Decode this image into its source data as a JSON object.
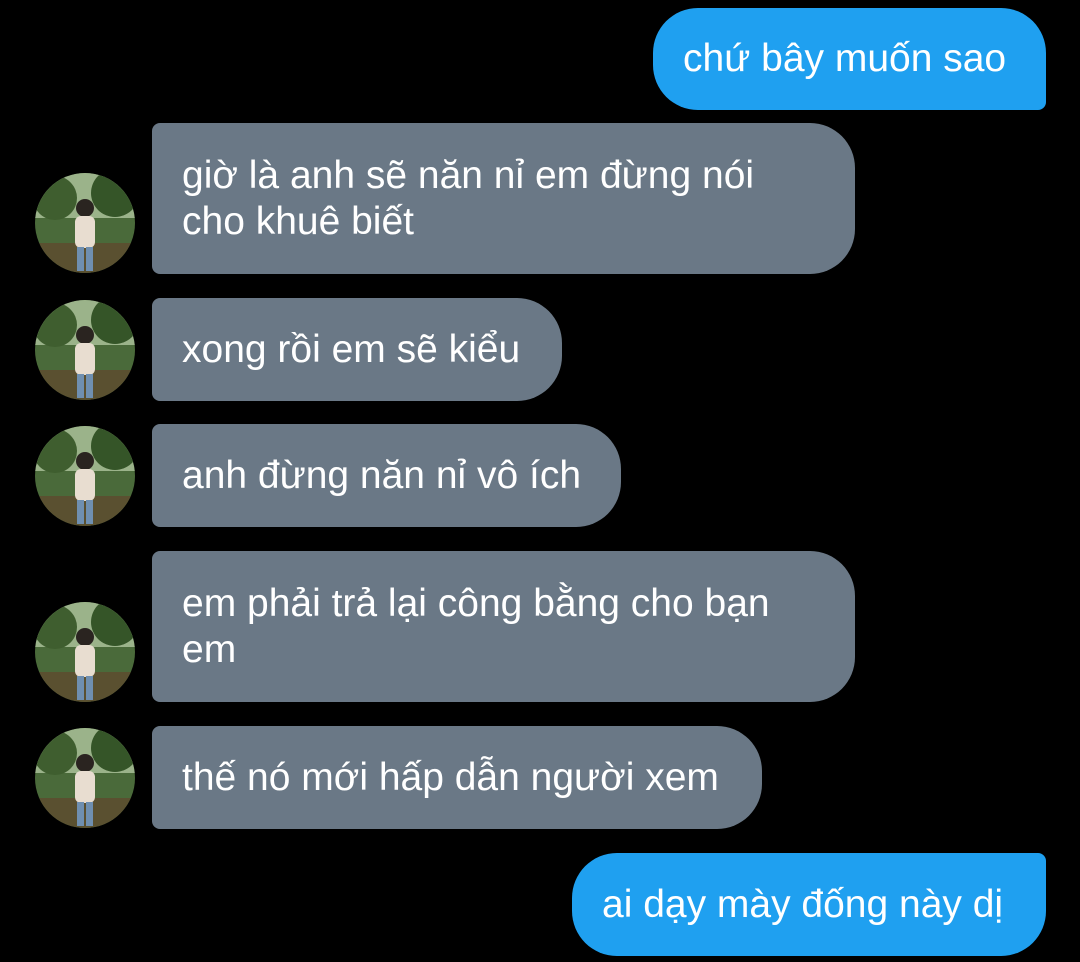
{
  "colors": {
    "background": "#000000",
    "outgoing_bubble": "#1fa0f0",
    "incoming_bubble": "#6a7886",
    "text": "#ffffff"
  },
  "messages": [
    {
      "direction": "outgoing",
      "text": "chứ bây muốn sao"
    },
    {
      "direction": "incoming",
      "text": "giờ là anh sẽ năn nỉ em đừng nói cho khuê biết",
      "avatar": "contact-avatar"
    },
    {
      "direction": "incoming",
      "text": "xong rồi em sẽ kiểu",
      "avatar": "contact-avatar"
    },
    {
      "direction": "incoming",
      "text": "anh đừng năn nỉ vô ích",
      "avatar": "contact-avatar"
    },
    {
      "direction": "incoming",
      "text": "em phải trả lại công bằng cho bạn em",
      "avatar": "contact-avatar"
    },
    {
      "direction": "incoming",
      "text": "thế nó mới hấp dẫn người xem",
      "avatar": "contact-avatar"
    },
    {
      "direction": "outgoing",
      "text": "ai dạy mày đống này dị"
    }
  ]
}
